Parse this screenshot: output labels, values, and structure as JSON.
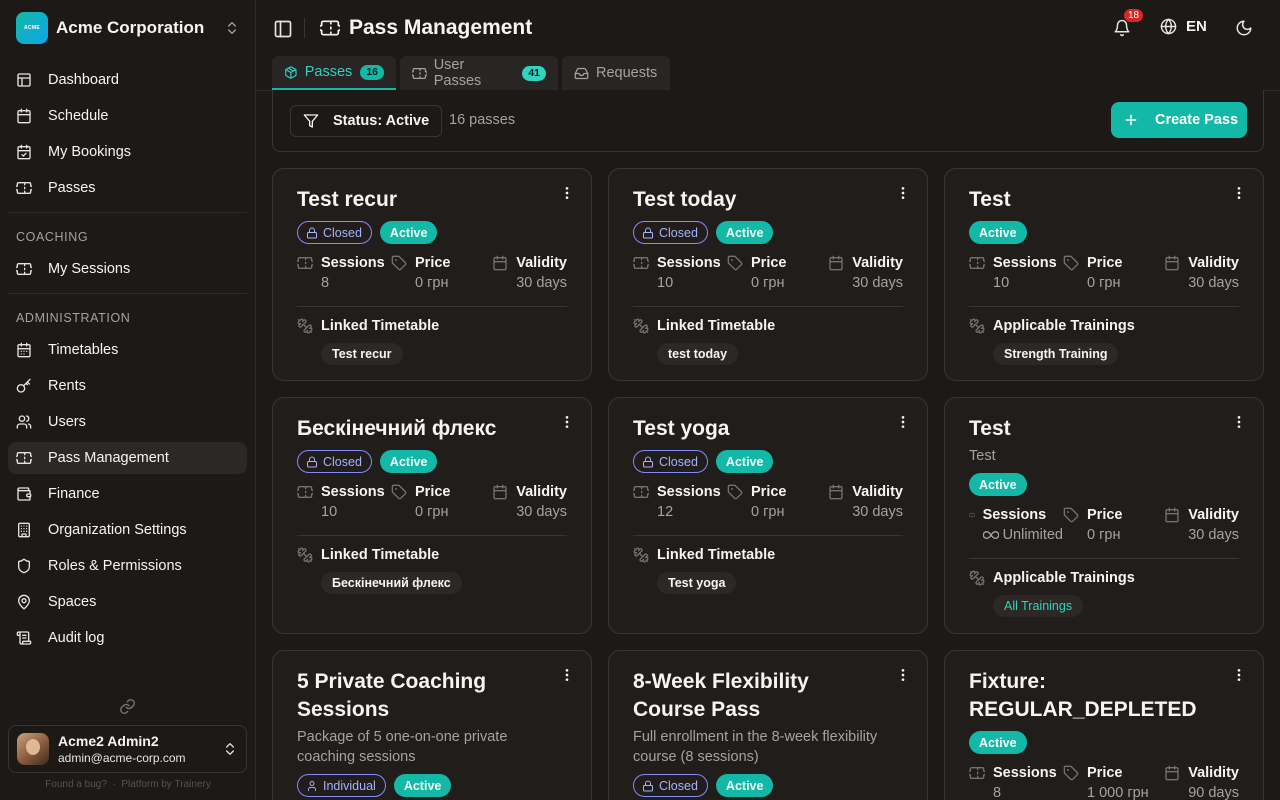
{
  "org": {
    "name": "Acme Corporation",
    "logo_text": "ACME"
  },
  "nav": {
    "main": [
      {
        "label": "Dashboard",
        "icon": "dashboard-icon"
      },
      {
        "label": "Schedule",
        "icon": "calendar-icon"
      },
      {
        "label": "My Bookings",
        "icon": "calendar-check-icon"
      },
      {
        "label": "Passes",
        "icon": "ticket-icon"
      }
    ],
    "coaching_label": "COACHING",
    "coaching": [
      {
        "label": "My Sessions",
        "icon": "ticket-icon"
      }
    ],
    "admin_label": "ADMINISTRATION",
    "admin": [
      {
        "label": "Timetables",
        "icon": "calendar-grid-icon"
      },
      {
        "label": "Rents",
        "icon": "key-icon"
      },
      {
        "label": "Users",
        "icon": "users-icon"
      },
      {
        "label": "Pass Management",
        "icon": "ticket-icon",
        "active": true
      },
      {
        "label": "Finance",
        "icon": "wallet-icon"
      },
      {
        "label": "Organization Settings",
        "icon": "building-icon"
      },
      {
        "label": "Roles & Permissions",
        "icon": "shield-icon"
      },
      {
        "label": "Spaces",
        "icon": "map-pin-icon"
      },
      {
        "label": "Audit log",
        "icon": "scroll-icon"
      }
    ]
  },
  "user": {
    "name": "Acme2 Admin2",
    "email": "admin@acme-corp.com"
  },
  "footer": {
    "bug": "Found a bug?",
    "dot": "·",
    "platform": "Platform by Trainery"
  },
  "header": {
    "title": "Pass Management",
    "notifications": "18",
    "language": "EN"
  },
  "tabs": [
    {
      "label": "Passes",
      "count": "16",
      "icon": "package-icon"
    },
    {
      "label": "User Passes",
      "count": "41",
      "icon": "ticket-icon"
    },
    {
      "label": "Requests",
      "icon": "inbox-icon"
    }
  ],
  "toolbar": {
    "filter_label": "Status: Active",
    "count_text": "16 passes",
    "create_label": "Create Pass"
  },
  "stat_labels": {
    "sessions": "Sessions",
    "price": "Price",
    "validity": "Validity"
  },
  "cards": [
    {
      "title": "Test recur",
      "badges": [
        "Closed",
        "Active"
      ],
      "sessions": "8",
      "price": "0 грн",
      "validity": "30 days",
      "section": "Linked Timetable",
      "chip": "Test recur"
    },
    {
      "title": "Test today",
      "badges": [
        "Closed",
        "Active"
      ],
      "sessions": "10",
      "price": "0 грн",
      "validity": "30 days",
      "section": "Linked Timetable",
      "chip": "test today"
    },
    {
      "title": "Test",
      "badges": [
        "Active"
      ],
      "sessions": "10",
      "price": "0 грн",
      "validity": "30 days",
      "section": "Applicable Trainings",
      "chip": "Strength Training"
    },
    {
      "title": "Бескінечний флекс",
      "badges": [
        "Closed",
        "Active"
      ],
      "sessions": "10",
      "price": "0 грн",
      "validity": "30 days",
      "section": "Linked Timetable",
      "chip": "Бескінечний флекс"
    },
    {
      "title": "Test yoga",
      "badges": [
        "Closed",
        "Active"
      ],
      "sessions": "12",
      "price": "0 грн",
      "validity": "30 days",
      "section": "Linked Timetable",
      "chip": "Test yoga"
    },
    {
      "title": "Test",
      "description": "Test",
      "badges": [
        "Active"
      ],
      "sessions": "Unlimited",
      "price": "0 грн",
      "validity": "30 days",
      "section": "Applicable Trainings",
      "chip": "All Trainings"
    },
    {
      "title": "5 Private Coaching Sessions",
      "description": "Package of 5 one-on-one private coaching sessions",
      "badges": [
        "Individual",
        "Active"
      ]
    },
    {
      "title": "8-Week Flexibility Course Pass",
      "description": "Full enrollment in the 8-week flexibility course (8 sessions)",
      "badges": [
        "Closed",
        "Active"
      ]
    },
    {
      "title": "Fixture: REGULAR_DEPLETED",
      "badges": [
        "Active"
      ],
      "sessions": "8",
      "price": "1 000 грн",
      "validity": "90 days"
    }
  ]
}
